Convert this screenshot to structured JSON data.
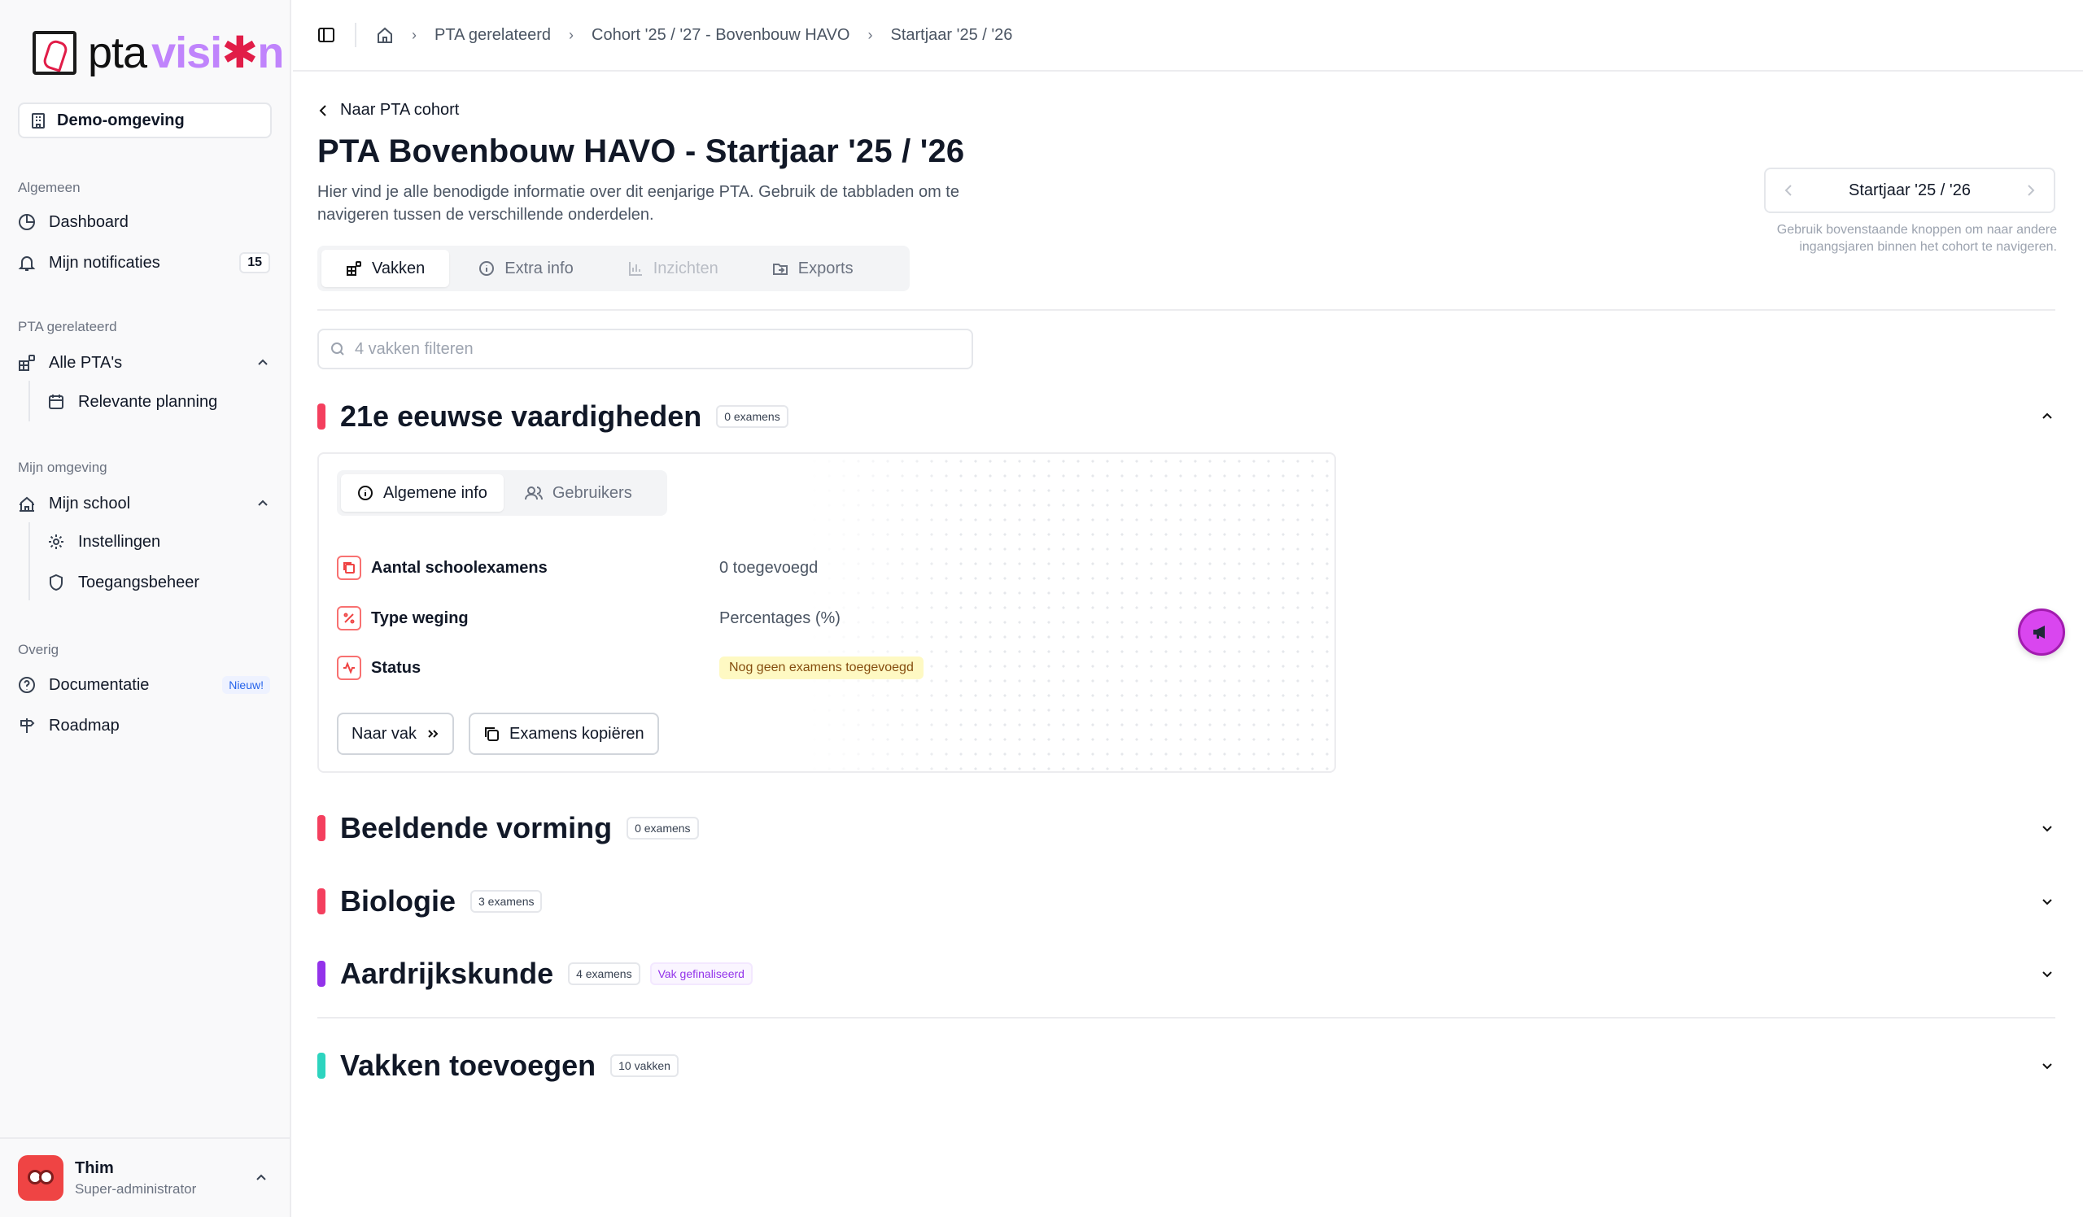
{
  "brand": {
    "pta": "pta",
    "vision_pre": "visi",
    "vision_star": "✱",
    "vision_post": "n"
  },
  "environment": "Demo-omgeving",
  "sidebar": {
    "sections": {
      "general": "Algemeen",
      "pta": "PTA gerelateerd",
      "mine": "Mijn omgeving",
      "other": "Overig"
    },
    "items": {
      "dashboard": "Dashboard",
      "notifications": "Mijn notificaties",
      "notifications_count": "15",
      "all_ptas": "Alle PTA's",
      "planning": "Relevante planning",
      "my_school": "Mijn school",
      "settings": "Instellingen",
      "access": "Toegangsbeheer",
      "docs": "Documentatie",
      "docs_badge": "Nieuw!",
      "roadmap": "Roadmap"
    }
  },
  "user": {
    "name": "Thim",
    "role": "Super-administrator"
  },
  "breadcrumb": {
    "items": [
      "PTA gerelateerd",
      "Cohort '25 / '27 - Bovenbouw HAVO",
      "Startjaar '25 / '26"
    ]
  },
  "page": {
    "back": "Naar PTA cohort",
    "title": "PTA Bovenbouw HAVO - Startjaar '25 / '26",
    "description": "Hier vind je alle benodigde informatie over dit eenjarige PTA. Gebruik de tabbladen om te navigeren tussen de verschillende onderdelen."
  },
  "tabs": {
    "vakken": "Vakken",
    "extra": "Extra info",
    "inzichten": "Inzichten",
    "exports": "Exports"
  },
  "year_nav": {
    "label": "Startjaar '25 / '26",
    "hint": "Gebruik bovenstaande knoppen om naar andere ingangsjaren binnen het cohort te navigeren."
  },
  "filter": {
    "placeholder": "4 vakken filteren"
  },
  "subjects": [
    {
      "name": "21e eeuwse vaardigheden",
      "count": "0 examens",
      "color": "#f43f5e"
    },
    {
      "name": "Beeldende vorming",
      "count": "0 examens",
      "color": "#f43f5e"
    },
    {
      "name": "Biologie",
      "count": "3 examens",
      "color": "#f43f5e"
    },
    {
      "name": "Aardrijkskunde",
      "count": "4 examens",
      "status": "Vak gefinaliseerd",
      "color": "#9333ea"
    }
  ],
  "add_subjects": {
    "name": "Vakken toevoegen",
    "count": "10 vakken",
    "color": "#2dd4bf"
  },
  "card": {
    "tabs": {
      "general": "Algemene info",
      "users": "Gebruikers"
    },
    "rows": [
      {
        "label": "Aantal schoolexamens",
        "value": "0 toegevoegd"
      },
      {
        "label": "Type weging",
        "value": "Percentages (%)"
      },
      {
        "label": "Status",
        "value": "Nog geen examens toegevoegd"
      }
    ],
    "buttons": {
      "goto": "Naar vak",
      "copy": "Examens kopiëren"
    }
  }
}
